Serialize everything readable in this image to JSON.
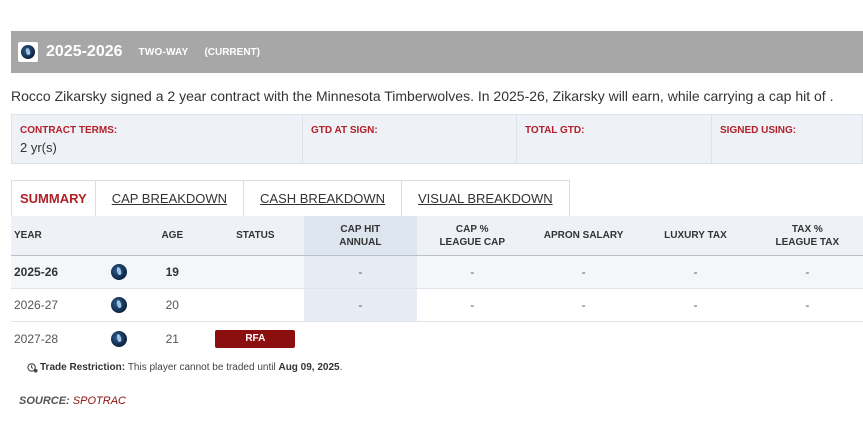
{
  "header": {
    "season": "2025-2026",
    "contract_type": "TWO-WAY",
    "status": "(CURRENT)",
    "team_logo": "timberwolves-logo"
  },
  "summary_text": "Rocco Zikarsky signed a 2 year contract with the Minnesota Timberwolves. In 2025-26, Zikarsky will earn, while carrying a cap hit of .",
  "terms": [
    {
      "label": "CONTRACT TERMS:",
      "value": "2 yr(s)"
    },
    {
      "label": "GTD AT SIGN:",
      "value": ""
    },
    {
      "label": "TOTAL GTD:",
      "value": ""
    },
    {
      "label": "SIGNED USING:",
      "value": ""
    }
  ],
  "tabs": [
    {
      "label": "SUMMARY",
      "active": true
    },
    {
      "label": "CAP BREAKDOWN",
      "active": false
    },
    {
      "label": "CASH BREAKDOWN",
      "active": false
    },
    {
      "label": "VISUAL BREAKDOWN",
      "active": false
    }
  ],
  "table": {
    "headers": {
      "year": "YEAR",
      "age": "AGE",
      "status": "STATUS",
      "cap_hit_1": "CAP HIT",
      "cap_hit_2": "ANNUAL",
      "cap_pct_1": "CAP %",
      "cap_pct_2": "LEAGUE CAP",
      "apron": "APRON SALARY",
      "luxury": "LUXURY TAX",
      "tax_pct_1": "TAX %",
      "tax_pct_2": "LEAGUE TAX"
    },
    "rows": [
      {
        "year": "2025-26",
        "age": "19",
        "status": "",
        "cap_hit": "-",
        "cap_pct": "-",
        "apron": "-",
        "luxury": "-",
        "tax_pct": "-"
      },
      {
        "year": "2026-27",
        "age": "20",
        "status": "",
        "cap_hit": "-",
        "cap_pct": "-",
        "apron": "-",
        "luxury": "-",
        "tax_pct": "-"
      },
      {
        "year": "2027-28",
        "age": "21",
        "status": "RFA",
        "cap_hit": "",
        "cap_pct": "",
        "apron": "",
        "luxury": "",
        "tax_pct": ""
      }
    ]
  },
  "trade_restriction": {
    "label": "Trade Restriction:",
    "text": "This player cannot be traded until",
    "date": "Aug 09, 2025",
    "end": "."
  },
  "source": {
    "label": "SOURCE:",
    "link": "SPOTRAC"
  },
  "colors": {
    "header_bg": "#a7a7a7",
    "accent_red": "#b2202a",
    "rfa_badge": "#8b0f0f"
  }
}
